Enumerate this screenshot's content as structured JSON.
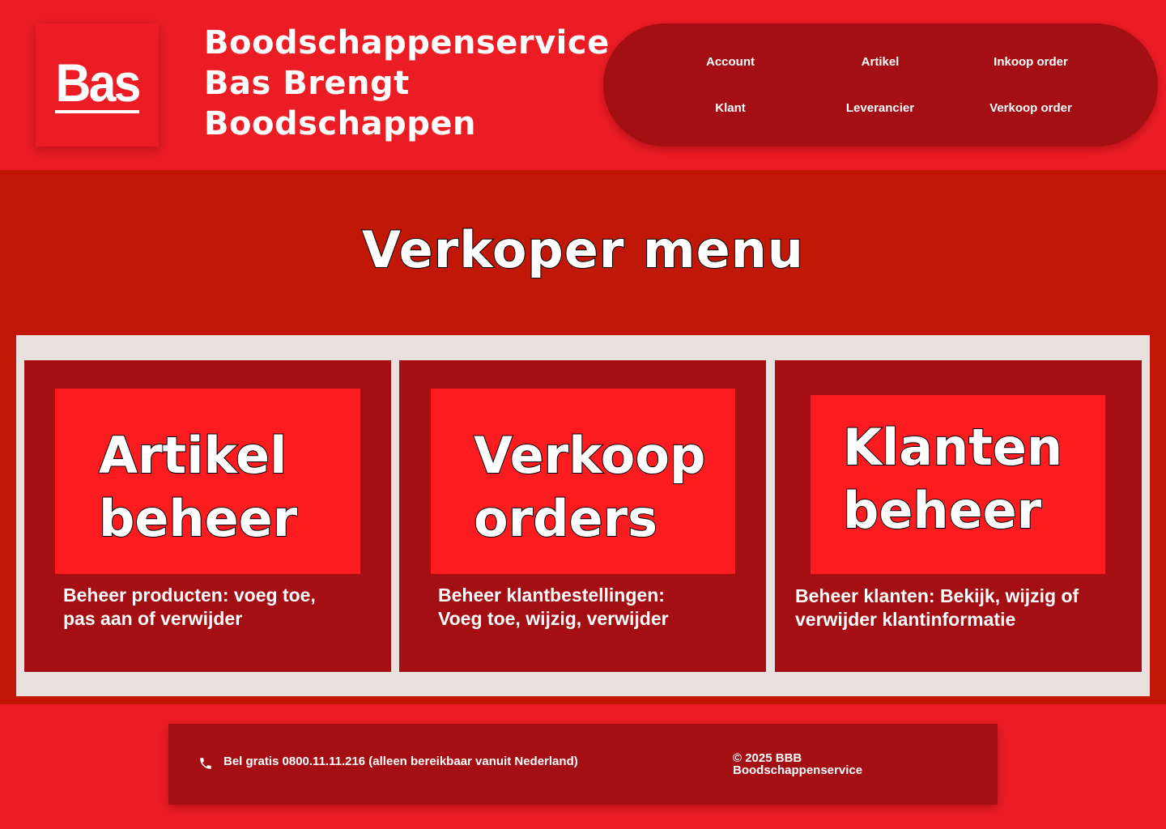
{
  "logo": {
    "text": "Bas"
  },
  "brand": {
    "lines": [
      "Boodschappenservice",
      "Bas Brengt",
      "Boodschappen"
    ]
  },
  "nav": {
    "items": [
      "Account",
      "Artikel",
      "Inkoop order",
      "Klant",
      "Leverancier",
      "Verkoop order"
    ]
  },
  "main": {
    "title": "Verkoper menu",
    "cards": [
      {
        "hero": [
          "Artikel",
          "beheer"
        ],
        "description": [
          "Beheer producten: voeg toe,",
          "pas aan of verwijder"
        ]
      },
      {
        "hero": [
          "Verkoop",
          "orders"
        ],
        "description": [
          "Beheer klantbestellingen:",
          "Voeg toe, wijzig, verwijder"
        ]
      },
      {
        "hero": [
          "Klanten",
          "beheer"
        ],
        "description": [
          "Beheer klanten: Bekijk, wijzig of",
          "verwijder klantinformatie"
        ]
      }
    ]
  },
  "footer": {
    "phone_icon": "phone-icon",
    "phone_text": "Bel gratis 0800.11.11.216 (alleen bereikbaar vanuit Nederland)",
    "copyright_lines": [
      "© 2025 BBB",
      "Boodschappenservice"
    ]
  },
  "colors": {
    "header_red": "#ec1c24",
    "dark_red": "#a30f13",
    "main_red": "#c11707",
    "hero_red": "#fc1c1f",
    "panel_bg": "#ebe0e0"
  }
}
